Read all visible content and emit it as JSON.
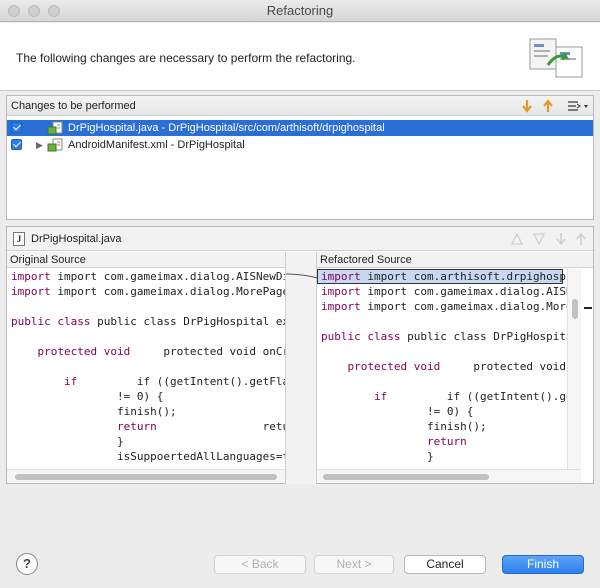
{
  "window": {
    "title": "Refactoring"
  },
  "banner": {
    "message": "The following changes are necessary to perform the refactoring."
  },
  "changes": {
    "header": "Changes to be performed",
    "items": [
      {
        "label": "DrPigHospital.java - DrPigHospital/src/com/arthisoft/drpighospital",
        "checked": true,
        "selected": true
      },
      {
        "label": "AndroidManifest.xml - DrPigHospital",
        "checked": true,
        "selected": false
      }
    ]
  },
  "source": {
    "file_title": "DrPigHospital.java",
    "original_label": "Original Source",
    "refactored_label": "Refactored Source",
    "original_lines": [
      "import com.gameimax.dialog.AISNewDialog",
      "import com.gameimax.dialog.MorePagerAda",
      "",
      "public class DrPigHospital extends AISA",
      "",
      "    protected void onCreate(Bundle save",
      "",
      "        if ((getIntent().getFlags() & I",
      "                != 0) {",
      "                finish();",
      "                return;",
      "                }",
      "        isSuppoertedAllLanguages=true;"
    ],
    "refactored_lines": [
      "import com.arthisoft.drpighospital.",
      "import com.gameimax.dialog.AISNewDi",
      "import com.gameimax.dialog.MorePage",
      "",
      "public class DrPigHospital extends",
      "",
      "    protected void onCreate(Bundle",
      "",
      "        if ((getIntent().getFlags(",
      "                != 0) {",
      "                finish();",
      "                return;",
      "                }"
    ]
  },
  "footer": {
    "help": "?",
    "back": "< Back",
    "next": "Next >",
    "cancel": "Cancel",
    "finish": "Finish"
  },
  "colors": {
    "selection": "#2a6fd6",
    "keyword": "#7f0055",
    "primary_button": "#2a7ff0"
  }
}
